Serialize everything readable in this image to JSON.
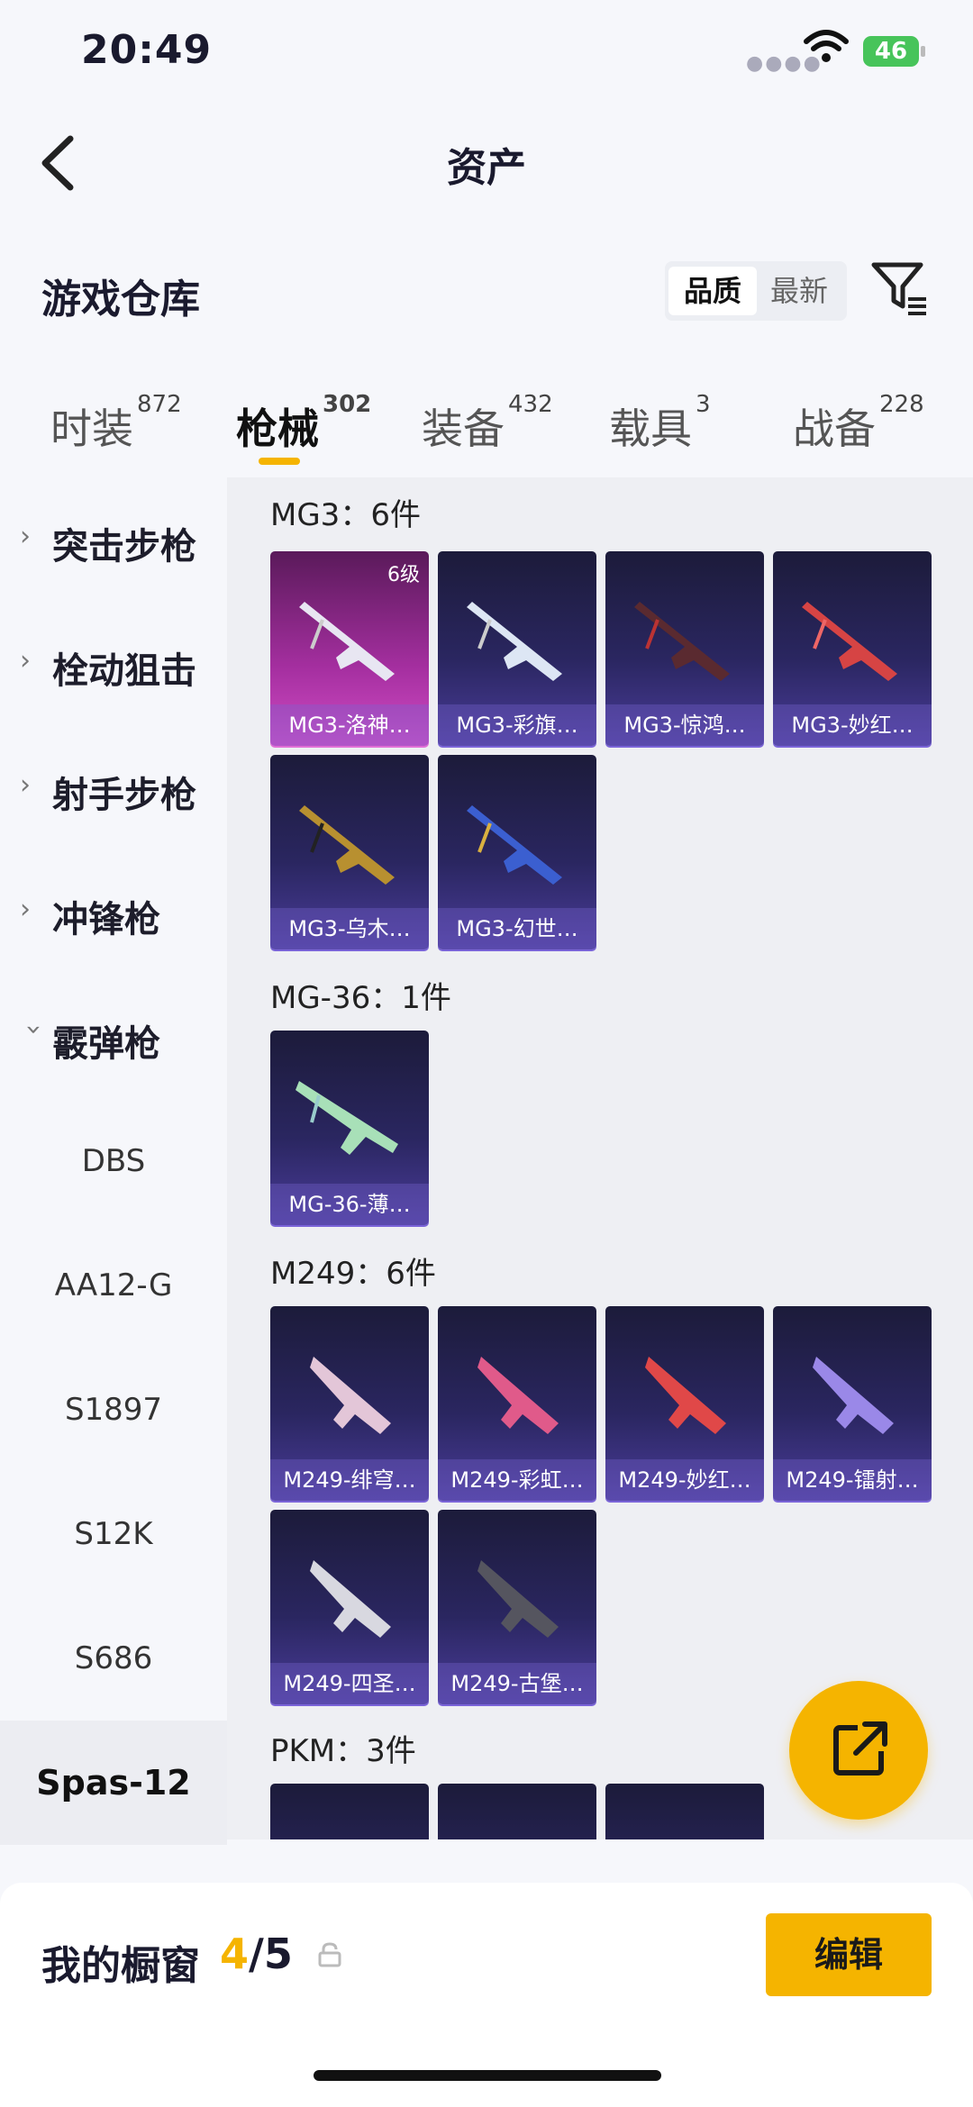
{
  "status_bar": {
    "time": "20:49",
    "battery": "46"
  },
  "header": {
    "title": "资产"
  },
  "warehouse": {
    "title": "游戏仓库",
    "sort_options": [
      "品质",
      "最新"
    ]
  },
  "tabs": [
    {
      "label": "时装",
      "count": "872"
    },
    {
      "label": "枪械",
      "count": "302"
    },
    {
      "label": "装备",
      "count": "432"
    },
    {
      "label": "载具",
      "count": "3"
    },
    {
      "label": "战备",
      "count": "228"
    }
  ],
  "sidebar": {
    "categories": [
      "突击步枪",
      "栓动狙击",
      "射手步枪",
      "冲锋枪",
      "霰弹枪"
    ],
    "subitems": [
      "DBS",
      "AA12-G",
      "S1897",
      "S12K",
      "S686",
      "Spas-12"
    ]
  },
  "groups": [
    {
      "title": "MG3：6件",
      "items": [
        "MG3-洛神…",
        "MG3-彩旗…",
        "MG3-惊鸿…",
        "MG3-妙红…",
        "MG3-乌木…",
        "MG3-幻世…"
      ],
      "level_badge": "6级"
    },
    {
      "title": "MG-36：1件",
      "items": [
        "MG-36-薄…"
      ]
    },
    {
      "title": "M249：6件",
      "items": [
        "M249-绯穹…",
        "M249-彩虹…",
        "M249-妙红…",
        "M249-镭射…",
        "M249-四圣…",
        "M249-古堡…"
      ]
    },
    {
      "title": "PKM：3件"
    }
  ],
  "showcase": {
    "title": "我的橱窗",
    "count_current": "4",
    "count_sep_total": "/5",
    "edit_label": "编辑"
  },
  "colors": {
    "accent": "#f5b400",
    "card_purple": "#2a2660",
    "card_pink": "#a52fa0"
  }
}
